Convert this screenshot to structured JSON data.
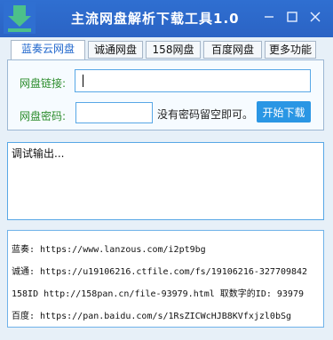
{
  "window": {
    "title": "主流网盘解析下载工具1.0",
    "controls": [
      "—",
      "□",
      "✕"
    ],
    "logo_icon": "download-arrow-icon",
    "accent_color": "#2f6fd1"
  },
  "tabs": [
    {
      "label": "蓝奏云网盘",
      "active": true
    },
    {
      "label": "诚通网盘",
      "active": false
    },
    {
      "label": "158网盘",
      "active": false
    },
    {
      "label": "百度网盘",
      "active": false
    },
    {
      "label": "更多功能",
      "active": false
    }
  ],
  "form": {
    "link_label": "网盘链接:",
    "link_value": "",
    "password_label": "网盘密码:",
    "password_value": "",
    "hint": "没有密码留空即可。",
    "start_button": "开始下载"
  },
  "debug": {
    "text": "调试输出..."
  },
  "links": [
    "蓝奏: https://www.lanzous.com/i2pt9bg",
    "诚通: https://u19106216.ctfile.com/fs/19106216-327709842",
    "158ID http://158pan.cn/file-93979.html 取数字的ID: 93979",
    "百度: https://pan.baidu.com/s/1RsZICWcHJB8KVfxjzl0bSg"
  ]
}
